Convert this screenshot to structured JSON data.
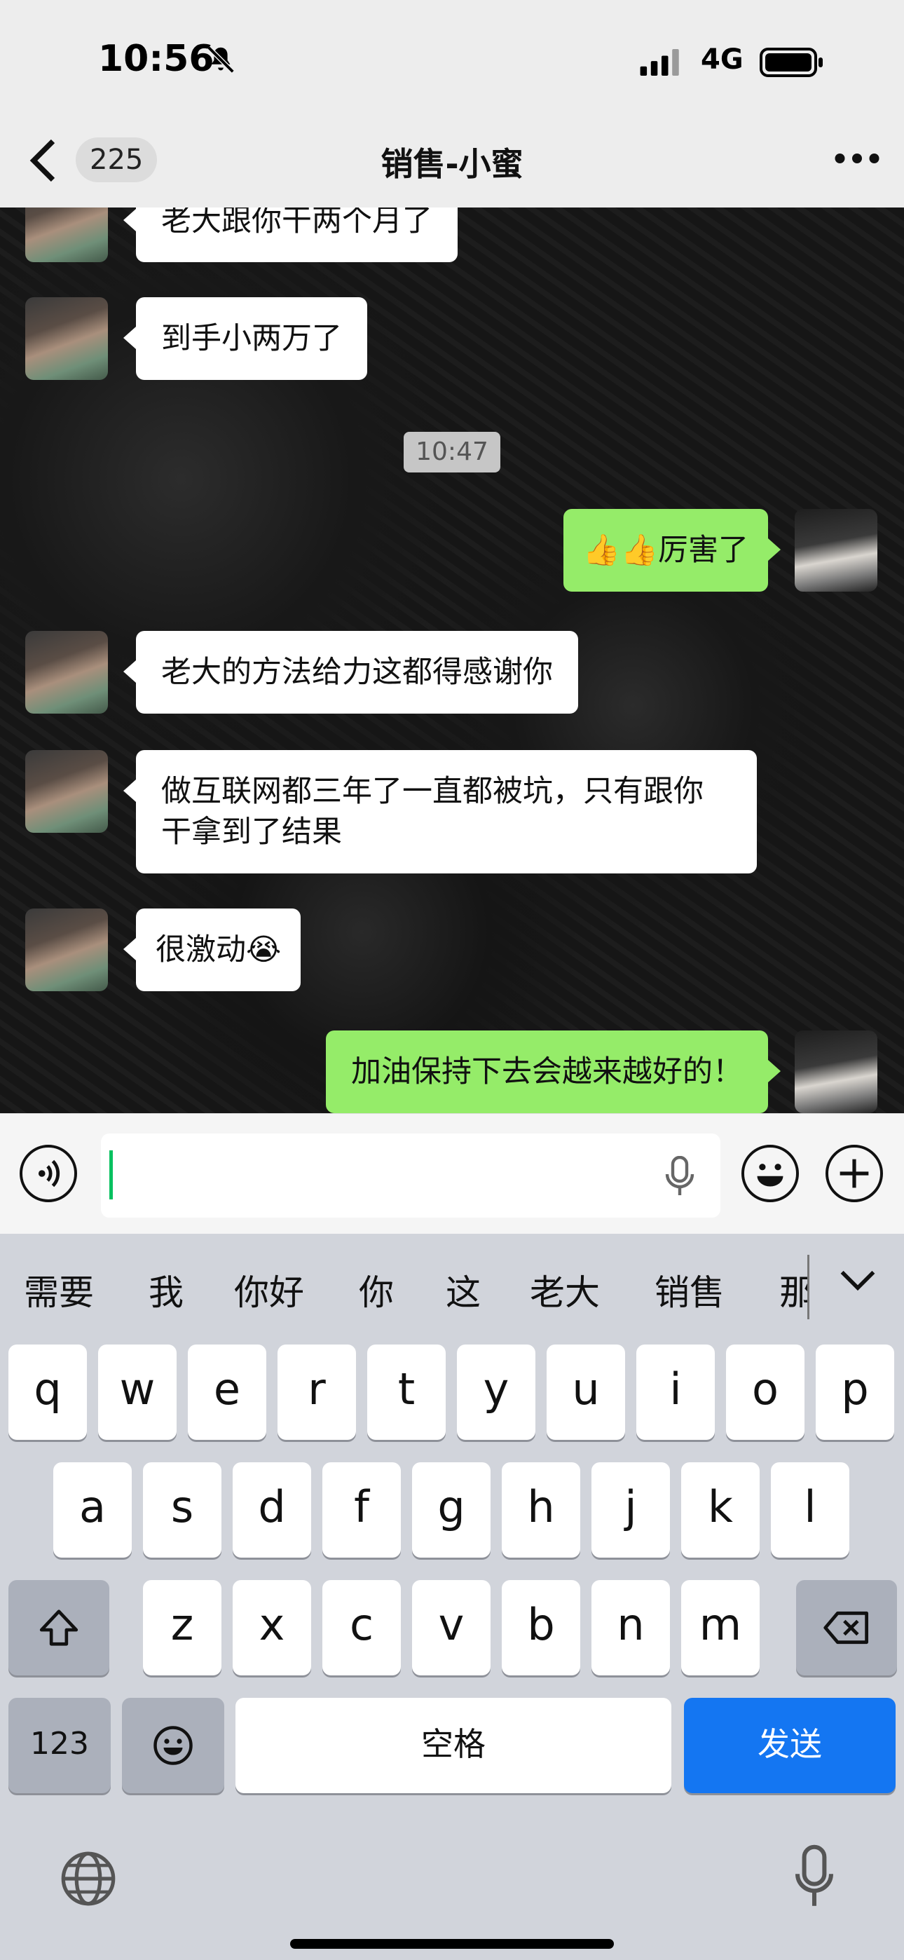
{
  "status_bar": {
    "time": "10:56",
    "network": "4G"
  },
  "header": {
    "unread_count": "225",
    "title": "销售-小蜜"
  },
  "messages": [
    {
      "side": "in",
      "text": "老大跟你干两个月了"
    },
    {
      "side": "in",
      "text": "到手小两万了"
    },
    {
      "timestamp": "10:47"
    },
    {
      "side": "out",
      "text": "👍👍厉害了"
    },
    {
      "side": "in",
      "text": "老大的方法给力这都得感谢你"
    },
    {
      "side": "in",
      "text": "做互联网都三年了一直都被坑，只有跟你干拿到了结果"
    },
    {
      "side": "in",
      "text": "很激动😭"
    },
    {
      "side": "out",
      "text": "加油保持下去会越来越好的！"
    }
  ],
  "input": {
    "value": ""
  },
  "keyboard": {
    "suggestions": [
      "需要",
      "我",
      "你好",
      "你",
      "这",
      "老大",
      "销售",
      "那"
    ],
    "row1": [
      "q",
      "w",
      "e",
      "r",
      "t",
      "y",
      "u",
      "i",
      "o",
      "p"
    ],
    "row2": [
      "a",
      "s",
      "d",
      "f",
      "g",
      "h",
      "j",
      "k",
      "l"
    ],
    "row3": [
      "z",
      "x",
      "c",
      "v",
      "b",
      "n",
      "m"
    ],
    "numbers_key": "123",
    "space_key": "空格",
    "send_key": "发送"
  }
}
